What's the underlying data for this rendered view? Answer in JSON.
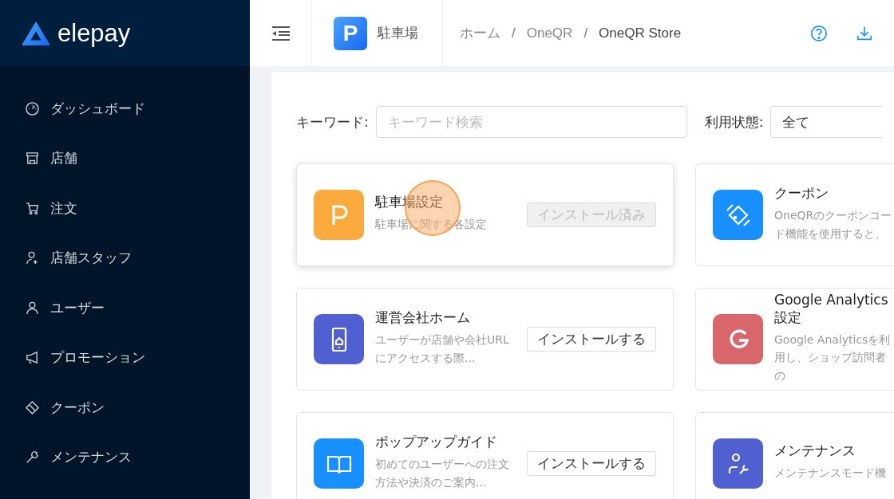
{
  "brand": {
    "name": "elepay"
  },
  "sidebar": {
    "items": [
      {
        "label": "ダッシュボード"
      },
      {
        "label": "店舗"
      },
      {
        "label": "注文"
      },
      {
        "label": "店舗スタッフ"
      },
      {
        "label": "ユーザー"
      },
      {
        "label": "プロモーション"
      },
      {
        "label": "クーポン"
      },
      {
        "label": "メンテナンス"
      }
    ]
  },
  "header": {
    "app_icon": "P",
    "app_name": "駐車場",
    "breadcrumbs": [
      "ホーム",
      "/",
      "OneQR",
      "/",
      "OneQR Store"
    ]
  },
  "filters": {
    "keyword_label": "キーワード:",
    "keyword_placeholder": "キーワード検索",
    "status_label": "利用状態:",
    "status_value": "全て"
  },
  "apps": [
    {
      "title": "駐車場設定",
      "description": "駐車場に関する各設定",
      "button": "インストール済み",
      "installed": true,
      "tapped": true
    },
    {
      "title": "クーポン",
      "description": "OneQRのクーポンコード機能を使用すると、",
      "tapped": false
    },
    {
      "title": "運営会社ホーム",
      "description": "ユーザーが店舗や会社URLにアクセスする際...",
      "button": "インストールする",
      "installed": false,
      "tapped": false
    },
    {
      "title": "Google Analytics設定",
      "description": "Google Analyticsを利用し、ショップ訪問者の",
      "tapped": false
    },
    {
      "title": "ポップアップガイド",
      "description": "初めてのユーザーへの注文方法や決済のご案内...",
      "button": "インストールする",
      "installed": false,
      "tapped": false
    },
    {
      "title": "メンテナンス",
      "description": "メンテナンスモード機",
      "tapped": false
    }
  ]
}
